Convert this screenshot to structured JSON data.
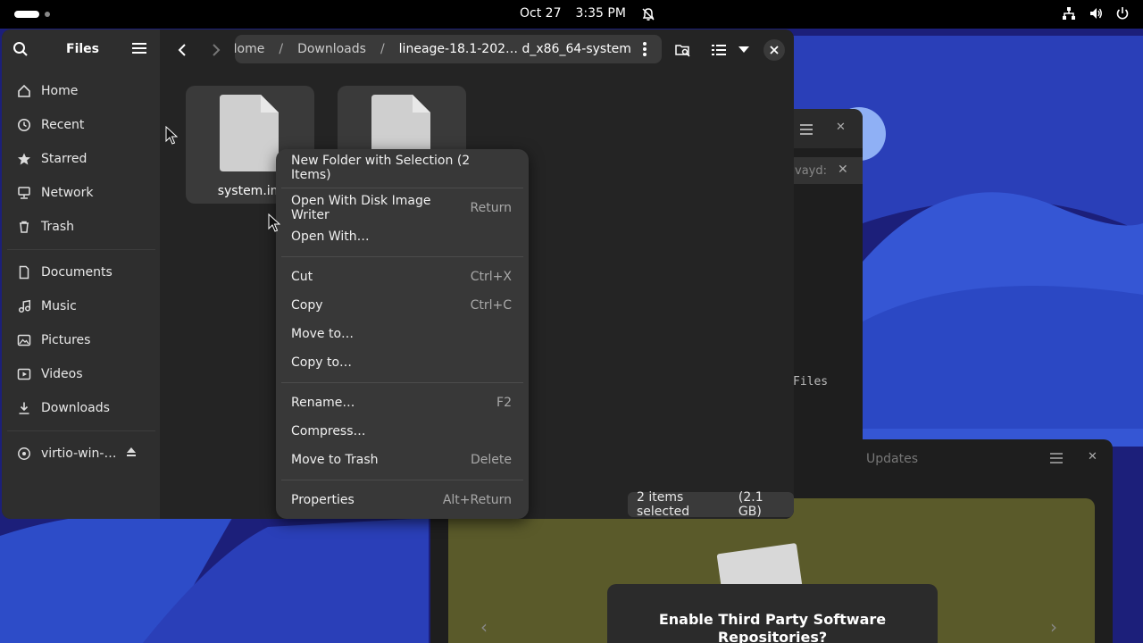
{
  "topbar": {
    "date": "Oct 27",
    "time": "3:35 PM"
  },
  "sidebar": {
    "title": "Files",
    "places": [
      {
        "label": "Home",
        "icon": "home-icon"
      },
      {
        "label": "Recent",
        "icon": "clock-icon"
      },
      {
        "label": "Starred",
        "icon": "star-icon"
      },
      {
        "label": "Network",
        "icon": "network-icon"
      },
      {
        "label": "Trash",
        "icon": "trash-icon"
      }
    ],
    "folders": [
      {
        "label": "Documents",
        "icon": "document-icon"
      },
      {
        "label": "Music",
        "icon": "music-icon"
      },
      {
        "label": "Pictures",
        "icon": "picture-icon"
      },
      {
        "label": "Videos",
        "icon": "video-icon"
      },
      {
        "label": "Downloads",
        "icon": "download-icon"
      }
    ],
    "devices": [
      {
        "label": "virtio-win-…",
        "icon": "disc-icon"
      }
    ]
  },
  "pathbar": {
    "crumbs": [
      "Home",
      "Downloads",
      "lineage-18.1-202… d_x86_64-system"
    ]
  },
  "files": [
    {
      "name": "system.im"
    },
    {
      "name": ""
    }
  ],
  "context_menu": {
    "groups": [
      [
        {
          "label": "New Folder with Selection (2 Items)",
          "accel": ""
        }
      ],
      [
        {
          "label": "Open With Disk Image Writer",
          "accel": "Return"
        },
        {
          "label": "Open With…",
          "accel": ""
        }
      ],
      [
        {
          "label": "Cut",
          "accel": "Ctrl+X"
        },
        {
          "label": "Copy",
          "accel": "Ctrl+C"
        },
        {
          "label": "Move to…",
          "accel": ""
        },
        {
          "label": "Copy to…",
          "accel": ""
        }
      ],
      [
        {
          "label": "Rename…",
          "accel": "F2"
        },
        {
          "label": "Compress…",
          "accel": ""
        },
        {
          "label": "Move to Trash",
          "accel": "Delete"
        }
      ],
      [
        {
          "label": "Properties",
          "accel": "Alt+Return"
        }
      ]
    ]
  },
  "status": {
    "selected": "2 items selected",
    "size": "(2.1 GB)"
  },
  "terminal": {
    "tab_text": "vayd:",
    "body_text": "Files"
  },
  "software": {
    "title": "Updates",
    "card_line1": "Enable Third Party Software",
    "card_line2": "Repositories?"
  },
  "colors": {
    "accent_wallpaper": "#3b5bd6",
    "wallpaper_dark": "#1a1c6e",
    "window_bg": "#242424",
    "sidebar_bg": "#2e2e2e",
    "menu_bg": "#383838"
  }
}
